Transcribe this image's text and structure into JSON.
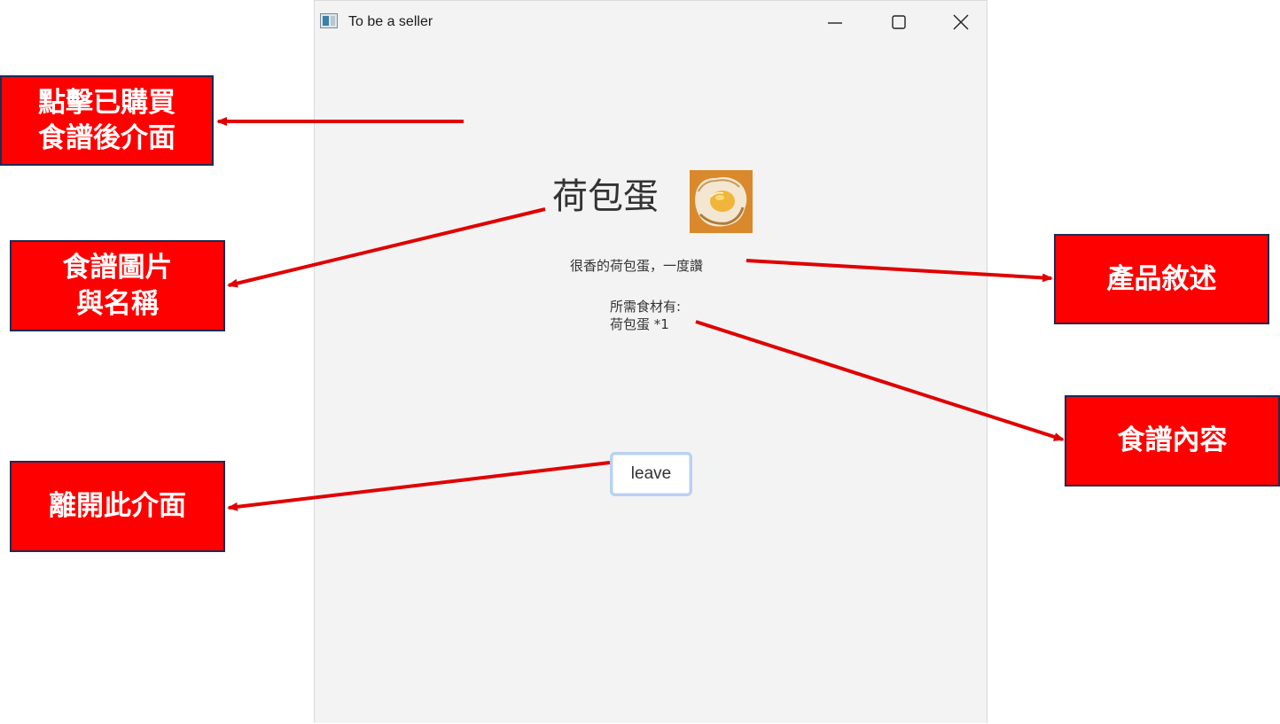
{
  "window": {
    "title": "To be a seller",
    "recipe_name": "荷包蛋",
    "recipe_image_alt": "fried egg",
    "description": "很香的荷包蛋，一度讚",
    "ingredients_header": "所需食材有:",
    "ingredients": [
      "荷包蛋 *1"
    ],
    "leave_label": "leave"
  },
  "callouts": {
    "after_purchase": "點擊已購買\n食譜後介面",
    "image_and_name": "食譜圖片\n與名稱",
    "description": "產品敘述",
    "content": "食譜內容",
    "leave": "離開此介面"
  },
  "colors": {
    "callout_bg": "#ff0000",
    "callout_border": "#1f2a52",
    "arrow": "#e00000",
    "window_bg": "#f3f3f3"
  }
}
